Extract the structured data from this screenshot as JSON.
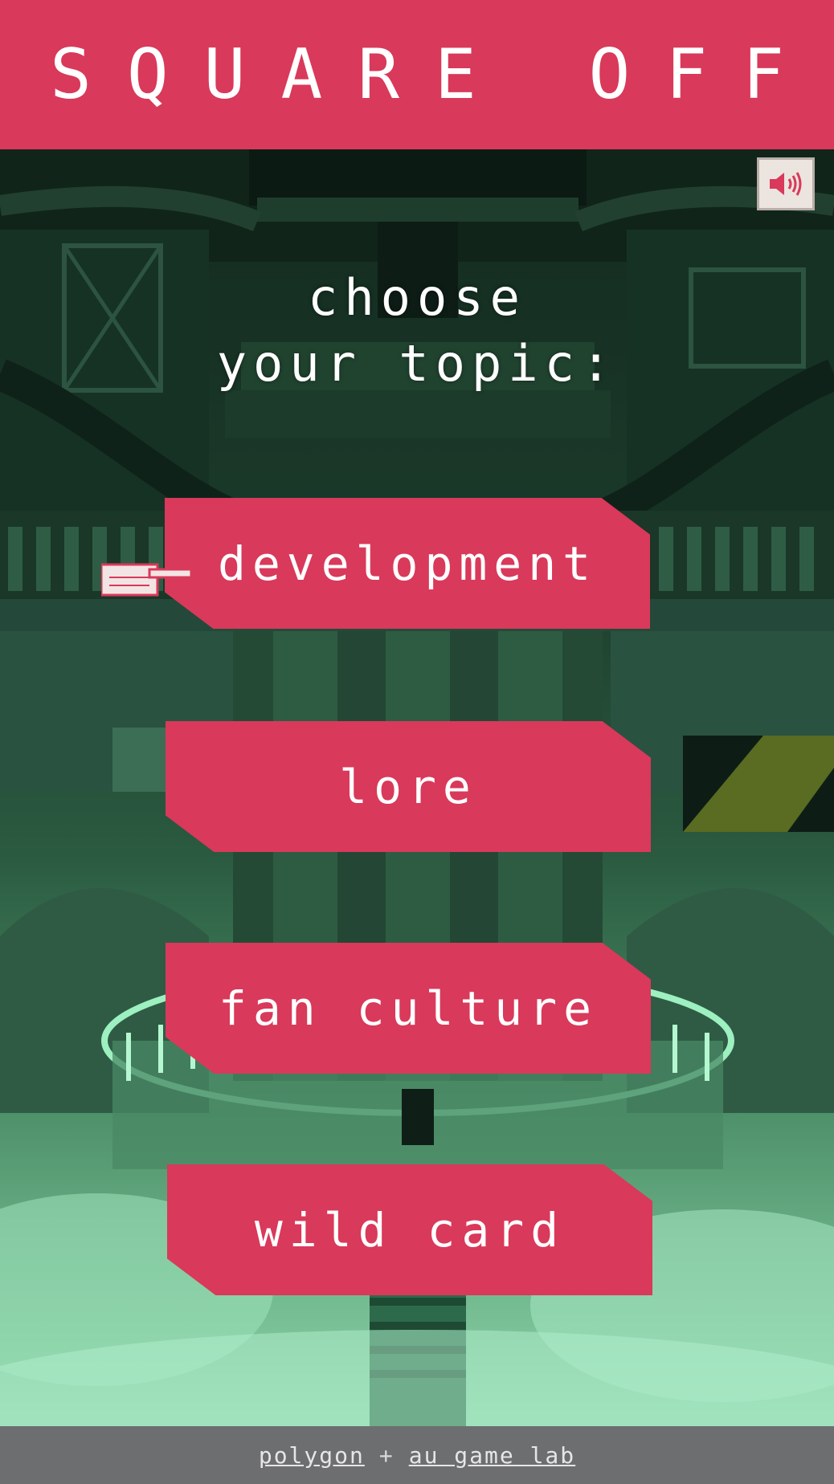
{
  "header": {
    "title": "SQUARE OFF"
  },
  "sound": {
    "icon": "speaker-icon"
  },
  "prompt": {
    "line1": "choose",
    "line2": "your topic:"
  },
  "topics": [
    {
      "label": "development",
      "selected": true
    },
    {
      "label": "lore"
    },
    {
      "label": "fan culture"
    },
    {
      "label": "wild card"
    }
  ],
  "footer": {
    "link1": "polygon",
    "separator": "+",
    "link2": "au game lab"
  },
  "colors": {
    "accent": "#d9395a",
    "footer_bg": "#6d6e70",
    "scene_dark": "#132a1f",
    "scene_light": "#8fd7ac"
  },
  "icons": {
    "pointer": "pointing-hand-icon",
    "sound": "speaker-icon"
  }
}
